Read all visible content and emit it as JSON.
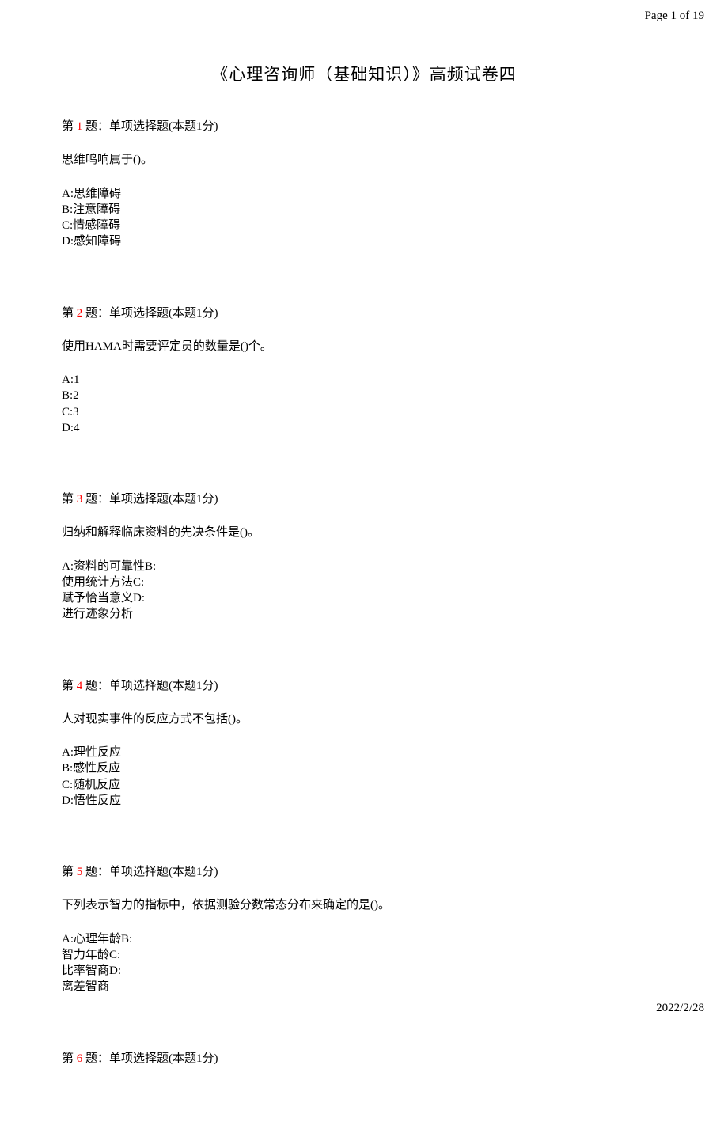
{
  "header": {
    "page_indicator": "Page 1 of 19"
  },
  "footer": {
    "date": "2022/2/28"
  },
  "title": "《心理咨询师（基础知识）》高频试卷四",
  "questions": [
    {
      "prefix": "第 ",
      "number": "1",
      "suffix": " 题：单项选择题(本题1分)",
      "stem": "思维鸣响属于()。",
      "options": "A:思维障碍\nB:注意障碍\nC:情感障碍\nD:感知障碍"
    },
    {
      "prefix": "第 ",
      "number": "2",
      "suffix": " 题：单项选择题(本题1分)",
      "stem": "使用HAMA时需要评定员的数量是()个。",
      "options": "A:1\nB:2\nC:3\nD:4"
    },
    {
      "prefix": "第 ",
      "number": "3",
      "suffix": " 题：单项选择题(本题1分)",
      "stem": "归纳和解释临床资料的先决条件是()。",
      "options": "A:资料的可靠性B:\n使用统计方法C:\n赋予恰当意义D:\n进行迹象分析"
    },
    {
      "prefix": "第 ",
      "number": "4",
      "suffix": " 题：单项选择题(本题1分)",
      "stem": "人对现实事件的反应方式不包括()。",
      "options": "A:理性反应\nB:感性反应\nC:随机反应\nD:悟性反应"
    },
    {
      "prefix": "第 ",
      "number": "5",
      "suffix": " 题：单项选择题(本题1分)",
      "stem": "下列表示智力的指标中，依据测验分数常态分布来确定的是()。",
      "options": "A:心理年龄B:\n智力年龄C:\n比率智商D:\n离差智商"
    },
    {
      "prefix": "第 ",
      "number": "6",
      "suffix": " 题：单项选择题(本题1分)",
      "stem": "",
      "options": ""
    }
  ]
}
